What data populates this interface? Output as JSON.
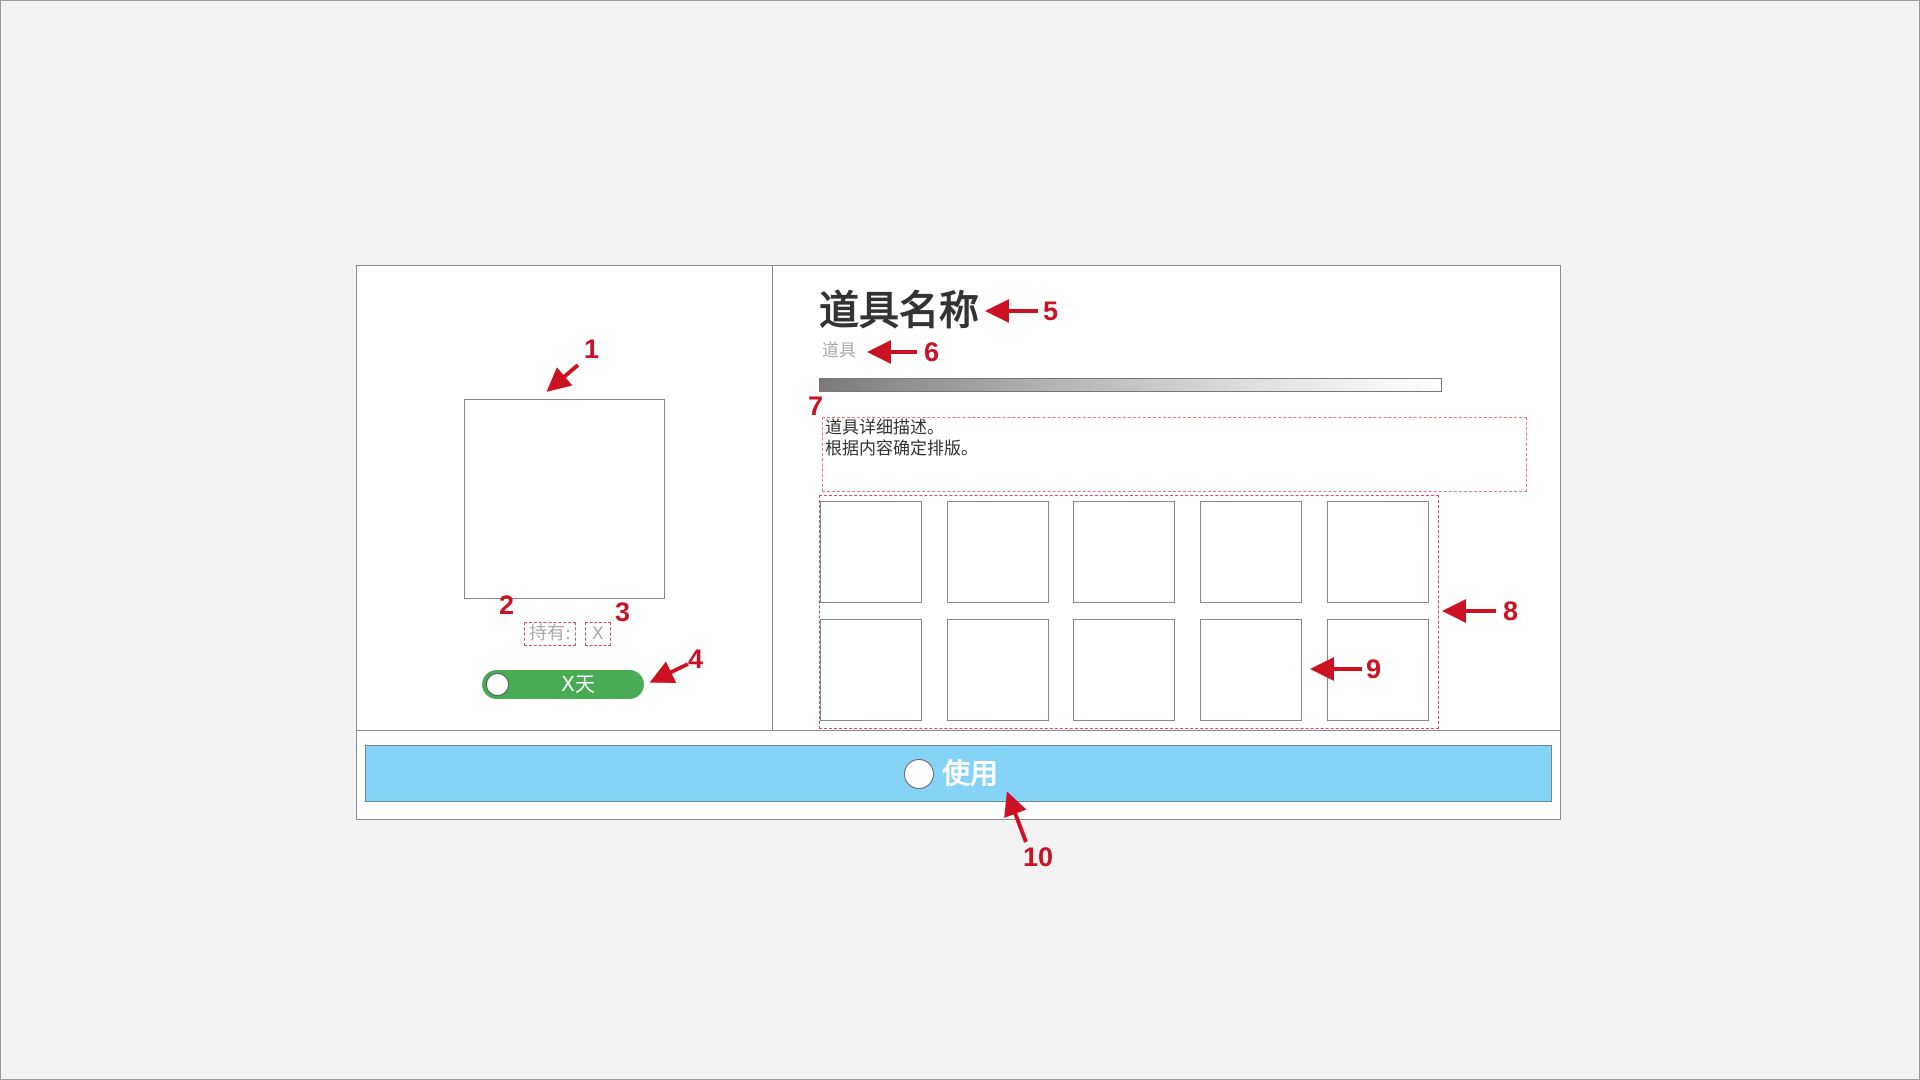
{
  "item": {
    "name": "道具名称",
    "type": "道具",
    "hold_label": "持有:",
    "hold_count": "X",
    "timer": "X天",
    "description": [
      "道具详细描述。",
      "根据内容确定排版。"
    ],
    "slots_count": 10
  },
  "action": {
    "use_label": "使用"
  },
  "callouts": [
    "1",
    "2",
    "3",
    "4",
    "5",
    "6",
    "7",
    "8",
    "9",
    "10"
  ],
  "colors": {
    "timer_badge": "#4aab55",
    "use_button": "#85d3f7",
    "callout": "#cc1122",
    "dashed_outline": "#d84a5a"
  }
}
